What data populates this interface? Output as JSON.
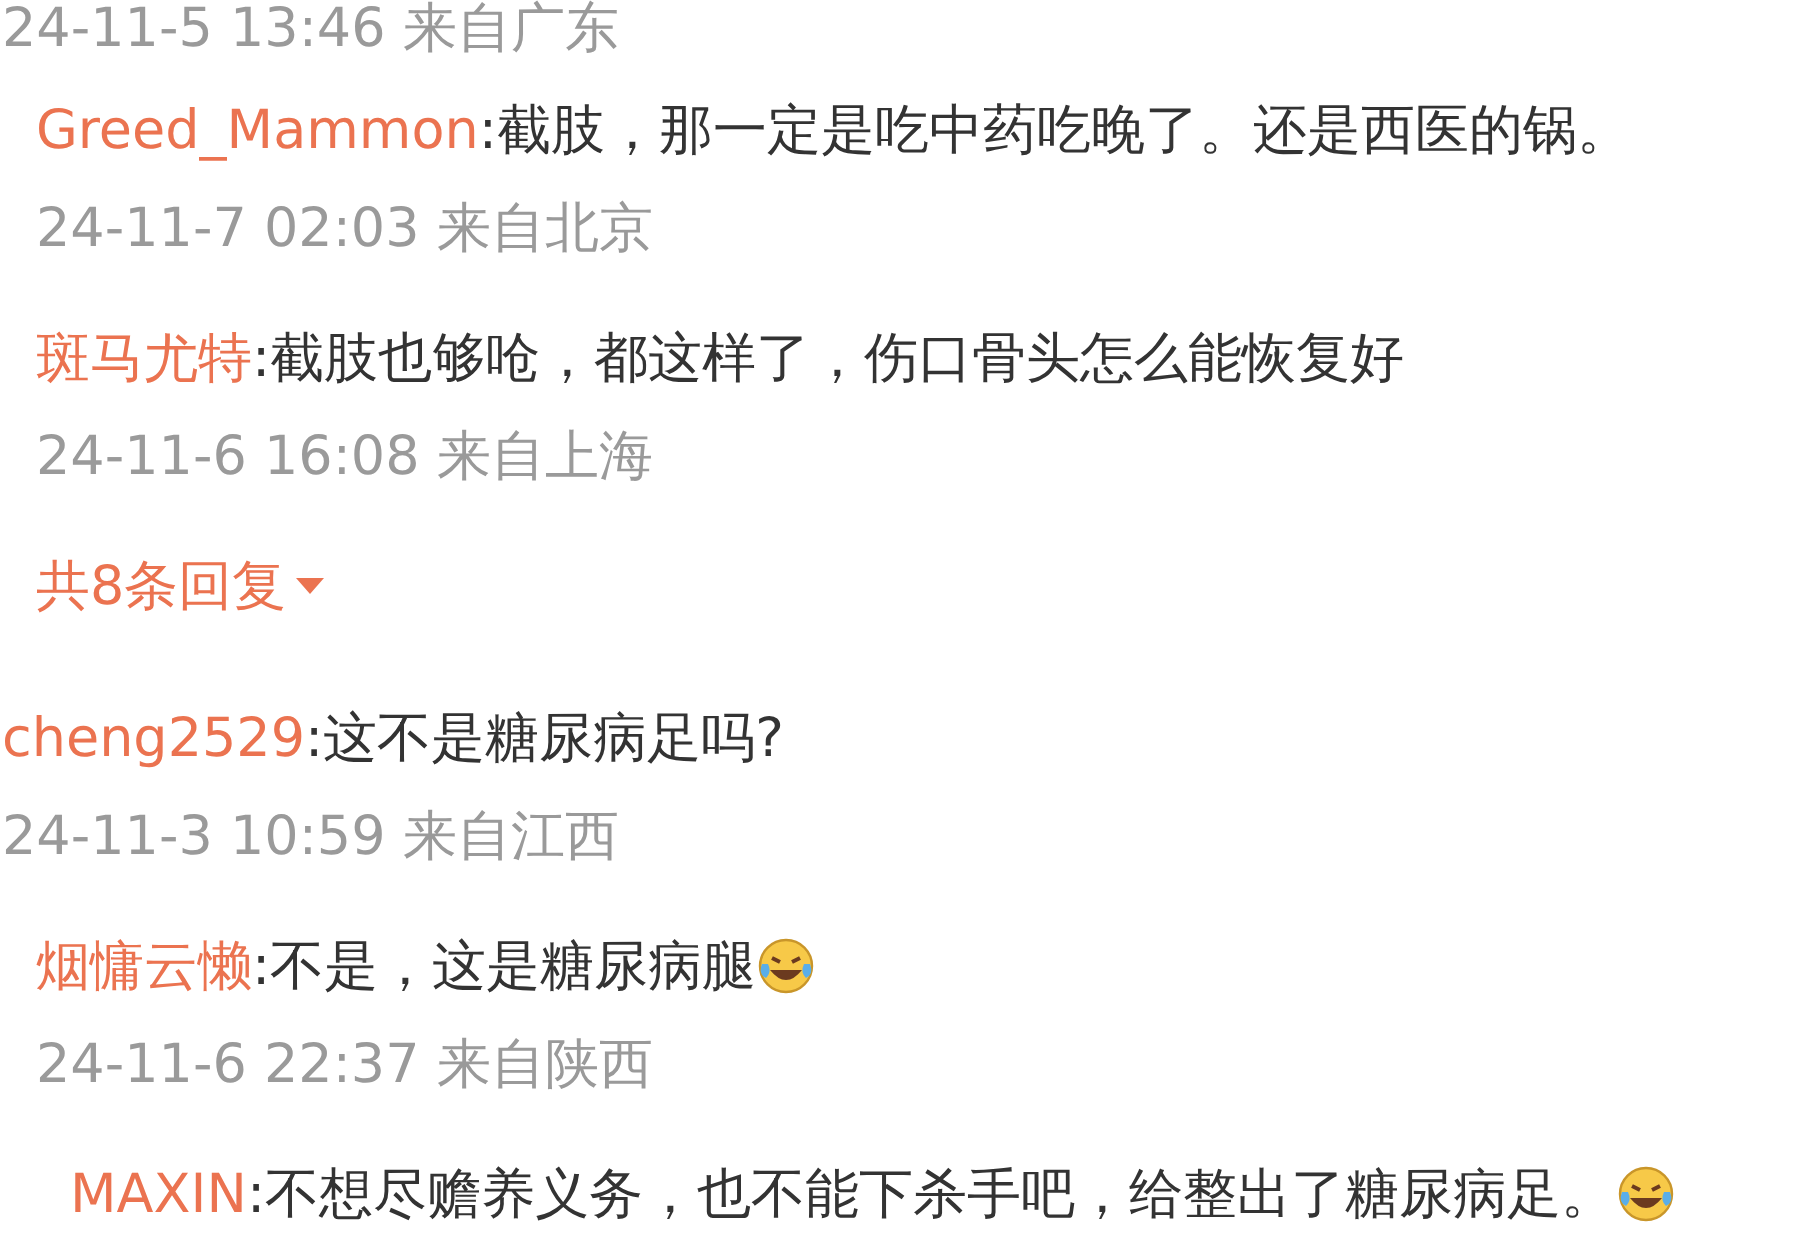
{
  "comments": [
    {
      "time": "24-11-5 13:46 来自广东",
      "replies": [
        {
          "name": "Greed_Mammon",
          "text": ":截肢，那一定是吃中药吃晚了。还是西医的锅。",
          "emoji": false,
          "time": "24-11-7 02:03 来自北京"
        },
        {
          "name": "斑马尤特",
          "text": ":截肢也够呛，都这样了，伤口骨头怎么能恢复好",
          "emoji": false,
          "time": "24-11-6 16:08 来自上海"
        }
      ],
      "more_replies": "共8条回复"
    },
    {
      "name": "cheng2529",
      "text": ":这不是糖尿病足吗?",
      "emoji": false,
      "time": "24-11-3 10:59 来自江西",
      "replies": [
        {
          "name": "烟慵云懒",
          "text": ":不是，这是糖尿病腿",
          "emoji": true,
          "time": "24-11-6 22:37 来自陕西",
          "children": [
            {
              "name": "MAXIN",
              "text": ":不想尽赡养义务，也不能下杀手吧，给整出了糖尿病足。",
              "emoji": true
            }
          ]
        }
      ]
    }
  ]
}
